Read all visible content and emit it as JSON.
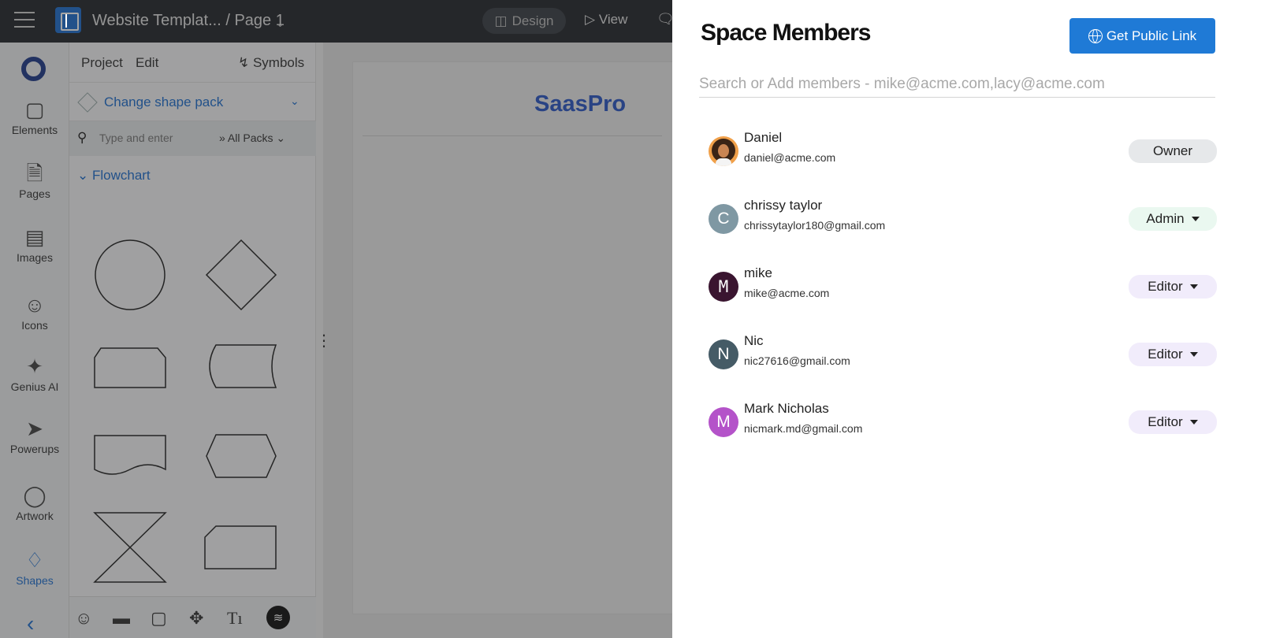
{
  "topbar": {
    "doc_title": "Website Templat... / Page 1",
    "design_label": "Design",
    "view_label": "View"
  },
  "rail": {
    "items": [
      {
        "label": "Elements",
        "icon": "cube-icon"
      },
      {
        "label": "Pages",
        "icon": "pages-icon"
      },
      {
        "label": "Images",
        "icon": "image-icon"
      },
      {
        "label": "Icons",
        "icon": "smiley-icon"
      },
      {
        "label": "Genius AI",
        "icon": "sparkle-icon"
      },
      {
        "label": "Powerups",
        "icon": "rocket-icon"
      },
      {
        "label": "Artwork",
        "icon": "ball-icon"
      },
      {
        "label": "Shapes",
        "icon": "diamond-icon"
      }
    ],
    "active": "Shapes"
  },
  "panel": {
    "tabs": [
      "Project",
      "Edit",
      "Symbols"
    ],
    "shape_pack_label": "Change shape pack",
    "search_placeholder": "Type and enter",
    "filter_label": "All Packs",
    "section_label": "Flowchart"
  },
  "canvas": {
    "brand_text": "SaasPro"
  },
  "members_panel": {
    "title": "Space Members",
    "public_link_label": "Get Public Link",
    "search_placeholder": "Search or Add members - mike@acme.com,lacy@acme.com",
    "members": [
      {
        "name": "Daniel",
        "email": "daniel@acme.com",
        "role": "Owner",
        "initial": "",
        "avatar_color": "#f0a04a"
      },
      {
        "name": "chrissy taylor",
        "email": "chrissytaylor180@gmail.com",
        "role": "Admin",
        "initial": "C",
        "avatar_color": "#7f98a3"
      },
      {
        "name": "mike",
        "email": "mike@acme.com",
        "role": "Editor",
        "initial": "M",
        "avatar_color": "#3a1530"
      },
      {
        "name": "Nic",
        "email": "nic27616@gmail.com",
        "role": "Editor",
        "initial": "N",
        "avatar_color": "#455b66"
      },
      {
        "name": "Mark Nicholas",
        "email": "nicmark.md@gmail.com",
        "role": "Editor",
        "initial": "M",
        "avatar_color": "#b453c9"
      }
    ]
  }
}
